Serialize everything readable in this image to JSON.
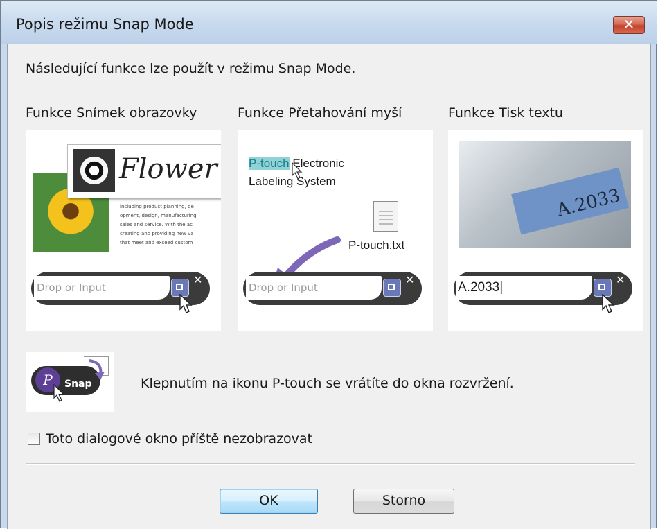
{
  "window": {
    "title": "Popis režimu Snap Mode",
    "close_glyph": "✕"
  },
  "intro": "Následující funkce lze použít v režimu Snap Mode.",
  "columns": [
    {
      "title": "Funkce Snímek obrazovky"
    },
    {
      "title": "Funkce Přetahování myší"
    },
    {
      "title": "Funkce Tisk textu"
    }
  ],
  "panel1": {
    "heading": "Flower",
    "body": "including product planning, de\nopment, design, manufacturing\nsales and service. With the ac\ncreating and providing new va\nthat meet and exceed custom",
    "input_placeholder": "Drop or Input"
  },
  "panel2": {
    "highlight": "P-touch",
    "line1_rest": " Electronic",
    "line2": "Labeling System",
    "file_name": "P-touch.txt",
    "input_placeholder": "Drop or Input"
  },
  "panel3": {
    "label_text": "A.2033",
    "input_value": "A.2033|"
  },
  "snap_icon": {
    "logo_letter": "P",
    "label": "Snap"
  },
  "snap_description": "Klepnutím na ikonu P-touch se vrátíte do okna rozvržení.",
  "dont_show": {
    "label": "Toto dialogové okno příště nezobrazovat",
    "checked": false
  },
  "buttons": {
    "ok": "OK",
    "cancel": "Storno"
  },
  "colors": {
    "titlebar": "#cbdcef",
    "close_button": "#c2432b",
    "ok_button_border": "#3c7fb1",
    "highlight": "#8fd3d6"
  }
}
